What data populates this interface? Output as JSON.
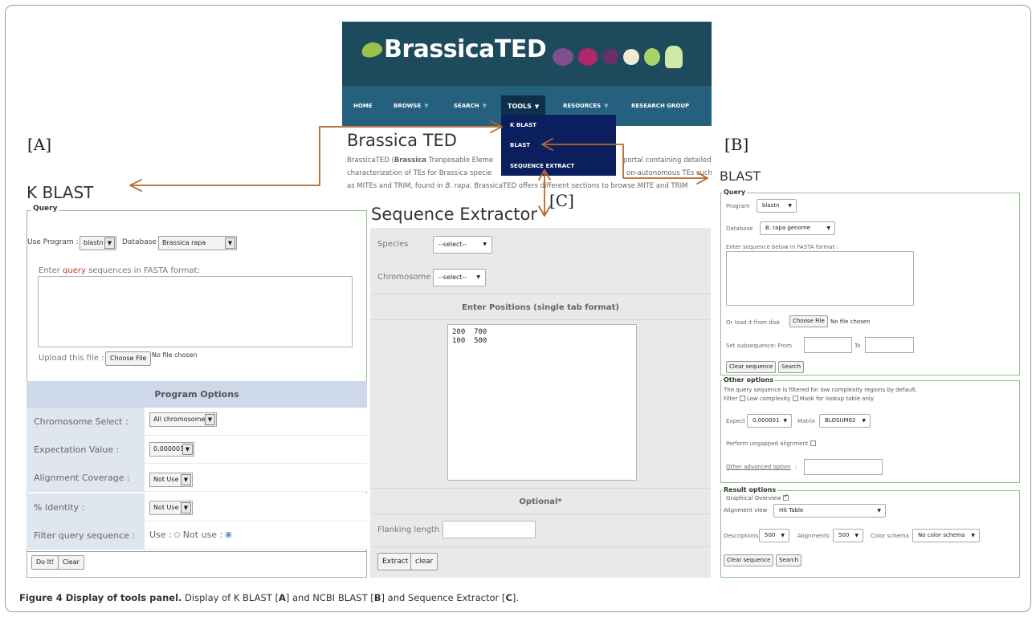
{
  "banner": {
    "logo_text": "BrassicaTED",
    "nav": [
      "HOME",
      "BROWSE",
      "SEARCH",
      "TOOLS",
      "RESOURCES",
      "RESEARCH GROUP"
    ],
    "tools_menu": [
      "K BLAST",
      "BLAST",
      "SEQUENCE EXTRACT"
    ]
  },
  "tags": {
    "a": "[A]",
    "b": "[B]",
    "c": "[C]"
  },
  "intro": {
    "title": "Brassica TED",
    "line1_a": "BrassicaTED (",
    "line1_b": "Brassica",
    "line1_c": " T",
    "line1_d": "ranposable Eleme",
    "line1_e": "portal containing detailed",
    "line2_a": "characterization of TEs for Brassica specie",
    "line2_b": "on-autonomous TEs such",
    "line3_a": "as MITEs and TRIM, found in ",
    "line3_b": "B. rapa",
    "line3_c": ". BrassicaTED offers different sections to browse MITE and TRIM"
  },
  "kblast": {
    "heading": "K BLAST",
    "legend": "Query",
    "use_program_label": "Use Program :",
    "program": "blastn",
    "database_label": "Database",
    "database": "Brassica rapa",
    "enter_prefix": "Enter ",
    "enter_query": "query",
    "enter_suffix": " sequences in FASTA format:",
    "upload_label": "Upload this file :",
    "choose_file": "Choose File",
    "no_file": "No file chosen",
    "program_options": "Program Options",
    "rows": [
      {
        "label": "Chromosome Select :",
        "value": "All chromosome"
      },
      {
        "label": "Expectation Value :",
        "value": "0.000001"
      },
      {
        "label": "Alignment Coverage :",
        "value": "Not Use"
      },
      {
        "label": "% Identity :",
        "value": "Not Use"
      },
      {
        "label": "Filter query sequence :",
        "value": ""
      }
    ],
    "filter_use": "Use :",
    "filter_not_use": "Not use :",
    "filter_selected": "Not use",
    "do_it": "Do It!",
    "clear": "Clear"
  },
  "extractor": {
    "heading": "Sequence Extractor",
    "species_label": "Species",
    "species_value": "--select--",
    "chromosome_label": "Chromosome",
    "chromosome_value": "--select--",
    "positions_header": "Enter Positions (single tab format)",
    "positions_text": "200  700\n100  500",
    "optional_header": "Optional*",
    "flanking_label": "Flanking length",
    "extract": "Extract",
    "clear": "clear"
  },
  "blast": {
    "heading": "BLAST",
    "query_legend": "Query",
    "program_label": "Program",
    "program": "blastn",
    "database_label": "Database",
    "database": "B. rapa genome",
    "enter_label": "Enter sequence below in FASTA format :",
    "load_label": "Or load it from disk",
    "choose_file": "Choose File",
    "no_file": "No file chosen",
    "subseq_label": "Set subsequence: From",
    "to_label": "To",
    "clear_sequence": "Clear sequence",
    "search": "Search",
    "other_legend": "Other options",
    "filtered_note": "The query sequence is filtered for low complexity regions by default.",
    "filter_label": "Filter",
    "low_complexity": "Low complexity",
    "mask_lookup": "Mask for lookup table only",
    "expect_label": "Expect",
    "expect": "0.000001",
    "matrix_label": "Matrix",
    "matrix": "BLOSUM62",
    "ungapped": "Perform ungapped alignment",
    "other_advanced": "Other advanced option",
    "result_legend": "Result options",
    "graphical_overview": "Graphical Overview",
    "alignment_view_label": "Alignment view",
    "alignment_view": "Hit Table",
    "descriptions_label": "Descriptions",
    "descriptions": "500",
    "alignments_label": "Alignments",
    "alignments": "500",
    "color_schema_label": "Color schema",
    "color_schema": "No color schema",
    "clear_sequence2": "Clear sequence",
    "search2": "Search"
  },
  "caption": {
    "title": "Figure 4 Display of tools panel.",
    "t1": " Display of K BLAST [",
    "a": "A",
    "t2": "] and NCBI BLAST [",
    "b": "B",
    "t3": "] and Sequence Extractor [",
    "c": "C",
    "t4": "]."
  },
  "colors": {
    "arrow": "#b5682a",
    "nav": "#26607f",
    "banner": "#1e4a5e",
    "menu": "#0b1f5e",
    "panel_border": "#8fc08a"
  }
}
